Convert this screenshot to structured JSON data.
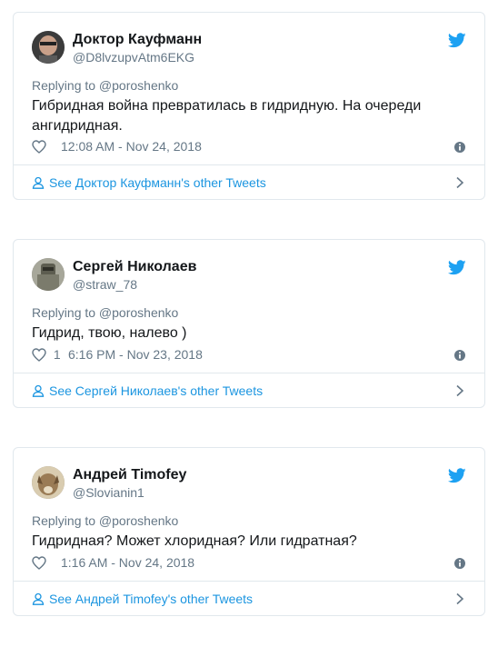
{
  "colors": {
    "accent": "#1da1f2",
    "link": "#1b95e0",
    "muted": "#657786",
    "border": "#e1e8ed",
    "text": "#14171a"
  },
  "tweets": [
    {
      "name": "Доктор Кауфманн",
      "handle": "@D8lvzupvAtm6EKG",
      "replying": "Replying to @poroshenko",
      "text": "Гибридная война превратилась в гидридную. На очереди ангидридная.",
      "likes": "",
      "time": "12:08 AM - Nov 24, 2018",
      "more": "See Доктор Кауфманн's other Tweets",
      "avatar_icon": "avatar-photo-icon"
    },
    {
      "name": "Сергей Николаев",
      "handle": "@straw_78",
      "replying": "Replying to @poroshenko",
      "text": "Гидрид, твою, налево )",
      "likes": "1",
      "time": "6:16 PM - Nov 23, 2018",
      "more": "See Сергей Николаев's other Tweets",
      "avatar_icon": "avatar-photo-icon"
    },
    {
      "name": "Андрей Timofey",
      "handle": "@Slovianin1",
      "replying": "Replying to @poroshenko",
      "text": "Гидридная? Может хлоридная? Или гидратная?",
      "likes": "",
      "time": "1:16 AM - Nov 24, 2018",
      "more": "See Андрей Timofey's other Tweets",
      "avatar_icon": "avatar-photo-icon"
    }
  ]
}
